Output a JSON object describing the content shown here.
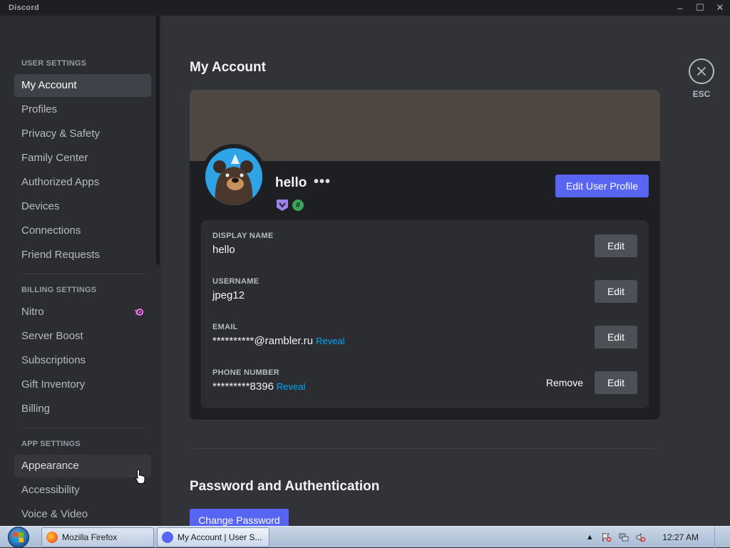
{
  "window": {
    "title": "Discord",
    "controls": [
      "–",
      "☐",
      "✕"
    ]
  },
  "sidebar": {
    "sections": [
      {
        "header": "USER SETTINGS",
        "items": [
          "My Account",
          "Profiles",
          "Privacy & Safety",
          "Family Center",
          "Authorized Apps",
          "Devices",
          "Connections",
          "Friend Requests"
        ]
      },
      {
        "header": "BILLING SETTINGS",
        "items": [
          "Nitro",
          "Server Boost",
          "Subscriptions",
          "Gift Inventory",
          "Billing"
        ]
      },
      {
        "header": "APP SETTINGS",
        "items": [
          "Appearance",
          "Accessibility",
          "Voice & Video"
        ]
      }
    ],
    "selected": "My Account",
    "hovered": "Appearance"
  },
  "main": {
    "title": "My Account",
    "close_label": "ESC",
    "profile": {
      "display_username": "hello",
      "more": "•••",
      "edit_profile_button": "Edit User Profile",
      "banner_color": "#4e4641",
      "avatar_color": "#2ea3e6"
    },
    "fields": [
      {
        "label": "DISPLAY NAME",
        "value": "hello",
        "reveal": "",
        "edit": "Edit",
        "remove": ""
      },
      {
        "label": "USERNAME",
        "value": "jpeg12",
        "reveal": "",
        "edit": "Edit",
        "remove": ""
      },
      {
        "label": "EMAIL",
        "value": "**********@rambler.ru",
        "reveal": "Reveal",
        "edit": "Edit",
        "remove": ""
      },
      {
        "label": "PHONE NUMBER",
        "value": "*********8396",
        "reveal": "Reveal",
        "edit": "Edit",
        "remove": "Remove"
      }
    ],
    "password_section": {
      "title": "Password and Authentication",
      "change_button": "Change Password"
    }
  },
  "taskbar": {
    "tasks": [
      {
        "label": "Mozilla Firefox",
        "icon": "firefox-icon",
        "active": false
      },
      {
        "label": "My Account | User S...",
        "icon": "discord-icon",
        "active": true
      }
    ],
    "clock": "12:27 AM"
  },
  "colors": {
    "accent": "#5865f2",
    "link": "#00a8fc",
    "nitro": "#ff73fa"
  }
}
